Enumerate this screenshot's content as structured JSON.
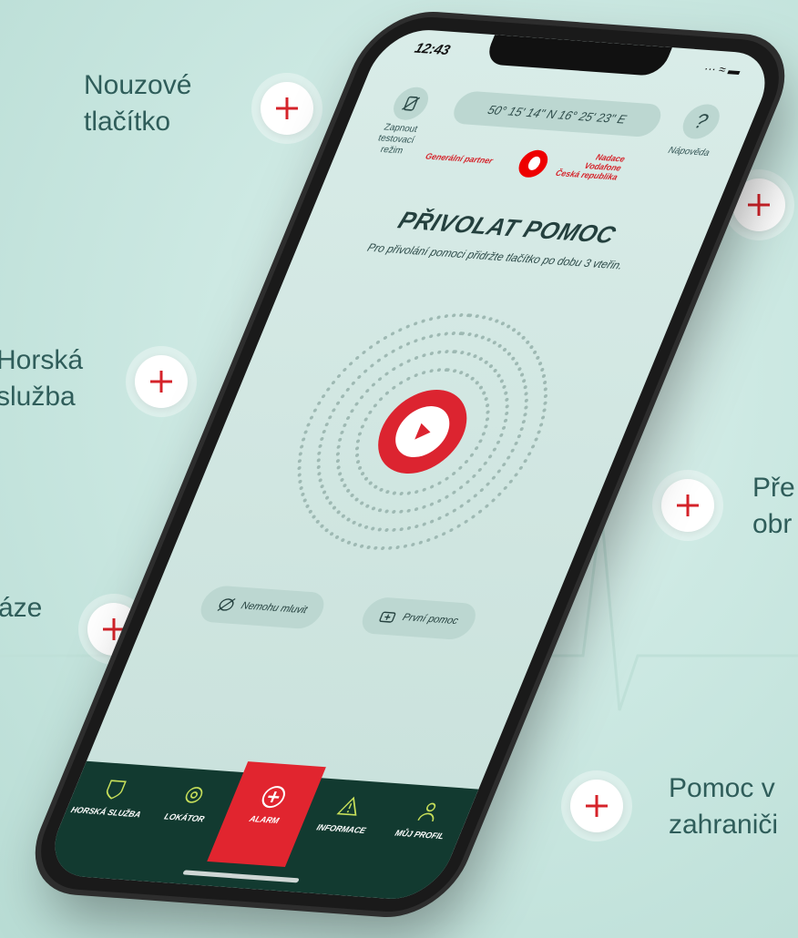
{
  "callouts": [
    {
      "label": "Nouzové\ntlačítko"
    },
    {
      "label": "Horská\nslužba"
    },
    {
      "label": "áze"
    },
    {
      "label": "Pře\nobr"
    },
    {
      "label": "Pomoc v\nzahraniči"
    }
  ],
  "status": {
    "time": "12:43",
    "icons": "··· ≈ ▬"
  },
  "header": {
    "test_mode_label": "Zapnout testovací režim",
    "coordinates": "50° 15' 14\" N 16° 25' 23\" E",
    "help_symbol": "?",
    "help_label": "Nápověda",
    "partner_label": "Generální partner",
    "foundation_label": "Nadace\nVodafone\nČeská republika"
  },
  "main": {
    "title": "PŘIVOLAT POMOC",
    "description": "Pro přivolání pomoci přidržte tlačítko po dobu 3 vteřin."
  },
  "actions": {
    "cannot_speak": "Nemohu mluvit",
    "first_aid": "První pomoc"
  },
  "tabs": [
    {
      "label": "HORSKÁ SLUŽBA",
      "icon": "mountain-service-icon"
    },
    {
      "label": "LOKÁTOR",
      "icon": "locator-icon"
    },
    {
      "label": "ALARM",
      "icon": "alarm-plus-icon"
    },
    {
      "label": "INFORMACE",
      "icon": "warning-icon"
    },
    {
      "label": "MŮJ PROFIL",
      "icon": "profile-icon"
    }
  ],
  "colors": {
    "accent": "#e1252f",
    "tabbar": "#123a30",
    "callout_text": "#2f5d5a"
  }
}
